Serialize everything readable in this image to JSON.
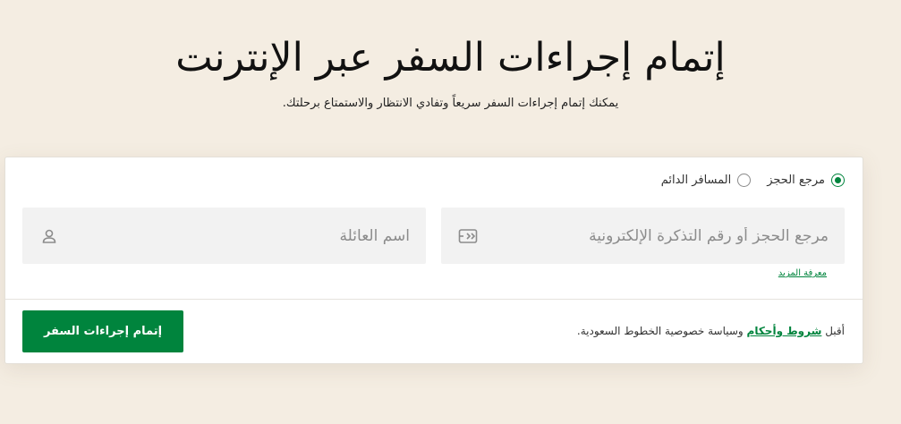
{
  "hero": {
    "title": "إتمام إجراءات السفر عبر الإنترنت",
    "subtitle": "يمكنك إتمام إجراءات السفر سريعاً وتفادي الانتظار والاستمتاع برحلتك."
  },
  "form": {
    "options": [
      {
        "label": "مرجع الحجز",
        "selected": true
      },
      {
        "label": "المسافر الدائم",
        "selected": false
      }
    ],
    "booking_field": {
      "placeholder": "مرجع الحجز أو رقم التذكرة الإلكترونية",
      "value": "",
      "icon": "ticket-icon"
    },
    "lastname_field": {
      "placeholder": "اسم العائلة",
      "value": "",
      "icon": "user-icon"
    },
    "learn_more": "معرفة المزيد",
    "terms": {
      "prefix": "أقبل ",
      "link": "شروط وأحكام",
      "suffix": " وسياسة خصوصية الخطوط السعودية."
    },
    "submit_label": "إتمام إجراءات السفر"
  },
  "colors": {
    "accent": "#00843d",
    "background": "#f4ede2"
  }
}
